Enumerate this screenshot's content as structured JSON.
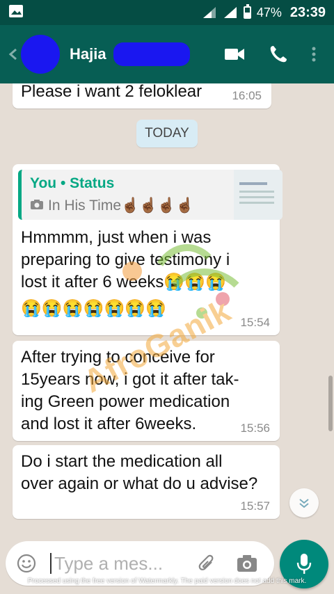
{
  "status_bar": {
    "battery": "47%",
    "battery_level": 0.47,
    "time": "23:39",
    "icons": [
      "image-icon",
      "signal-icon",
      "signal-icon",
      "battery-icon"
    ]
  },
  "header": {
    "contact_name": "Hajia",
    "icons": [
      "back-arrow-icon",
      "video-call-icon",
      "phone-icon",
      "more-vert-icon"
    ]
  },
  "messages": [
    {
      "text": "Please i want 2 feloklear",
      "time": "16:05"
    },
    {
      "day_divider": "TODAY"
    },
    {
      "quote": {
        "author": "You • Status",
        "subtitle": "In His Time☝🏾☝🏾☝🏾☝🏾"
      },
      "text_lines": [
        "Hmmmm, just when i was",
        "preparing to give testimony i",
        "lost it after 6 weeks😭😭😭",
        "😭😭😭😭😭😭😭"
      ],
      "time": "15:54"
    },
    {
      "text_lines": [
        "After trying to conceive for",
        "15years now,  i got it after tak-",
        "ing  Green power medication",
        "and lost it after 6weeks."
      ],
      "time": "15:56"
    },
    {
      "text_lines": [
        "Do i start the medication all",
        "over again or what do u advise?"
      ],
      "time": "15:57"
    }
  ],
  "watermark": {
    "text": "AfroGanik"
  },
  "input": {
    "placeholder": "Type a mes...",
    "icons": [
      "emoji-icon",
      "attach-icon",
      "camera-icon",
      "mic-icon"
    ]
  },
  "footer_note": "Processed using the free version of Watermarkly. The paid version does not add this mark.",
  "colors": {
    "header": "#075e54",
    "status_bar": "#054d44",
    "accent": "#06a884",
    "fab": "#00897b",
    "chat_bg": "#e5ddd5"
  }
}
